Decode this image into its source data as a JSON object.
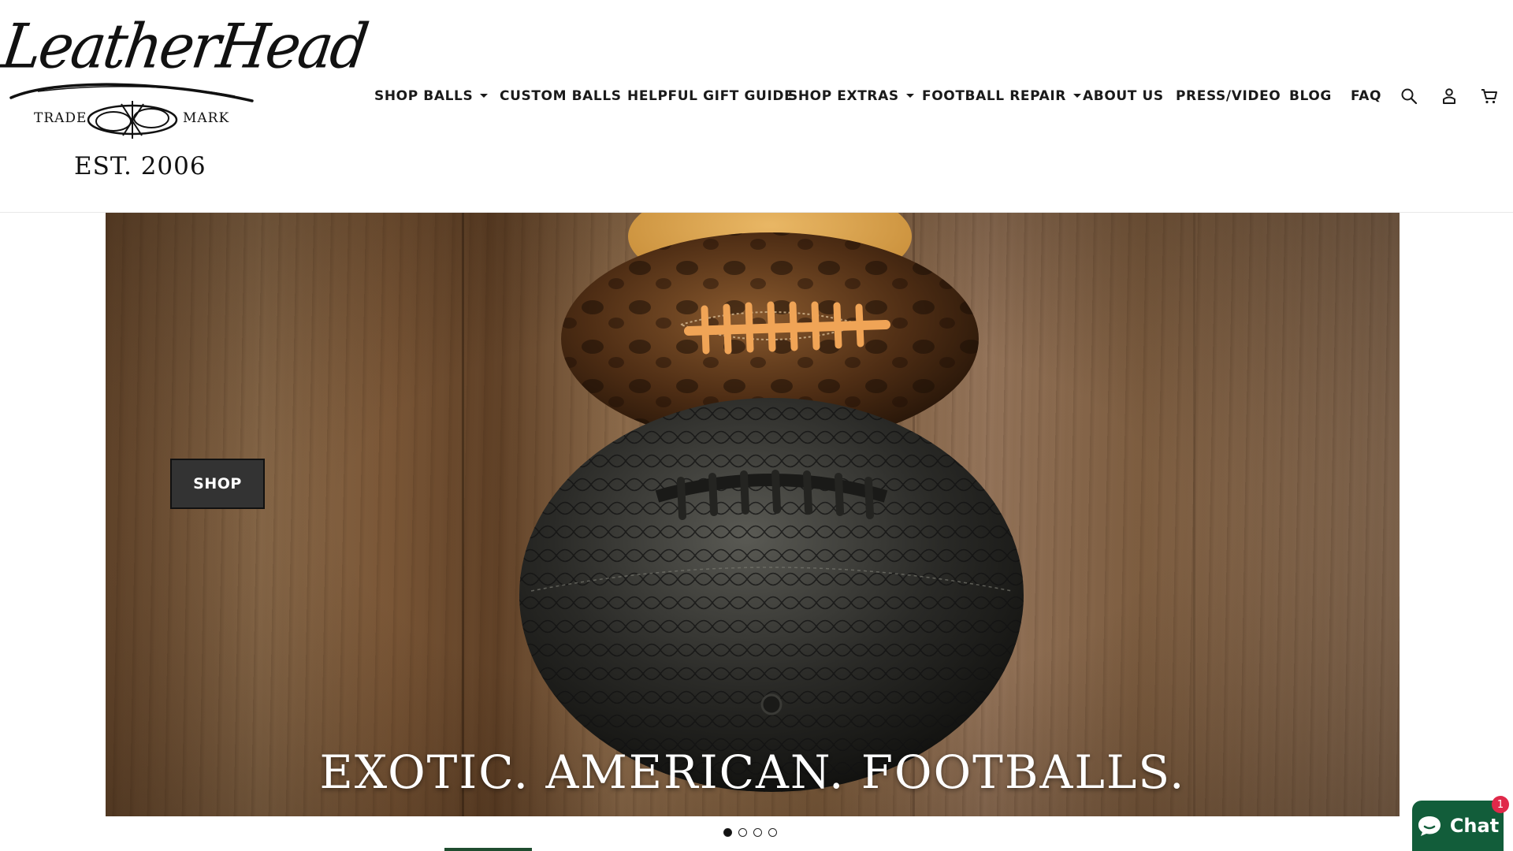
{
  "brand": {
    "script_name": "LeatherHead",
    "trade": "TRADE",
    "mark": "MARK",
    "established": "EST. 2006"
  },
  "nav": {
    "items": [
      {
        "label": "SHOP BALLS",
        "has_dropdown": true
      },
      {
        "label": "CUSTOM BALLS",
        "has_dropdown": false
      },
      {
        "label": "HELPFUL GIFT GUIDE",
        "has_dropdown": false
      },
      {
        "label": "SHOP EXTRAS",
        "has_dropdown": true
      },
      {
        "label": "FOOTBALL REPAIR",
        "has_dropdown": true
      },
      {
        "label": "ABOUT US",
        "has_dropdown": false
      },
      {
        "label": "PRESS/VIDEO",
        "has_dropdown": false
      },
      {
        "label": "BLOG",
        "has_dropdown": false
      },
      {
        "label": "FAQ",
        "has_dropdown": false
      }
    ],
    "icons": [
      "search-icon",
      "account-icon",
      "cart-icon"
    ]
  },
  "hero": {
    "button_label": "SHOP",
    "tagline": "EXOTIC.  AMERICAN.  FOOTBALLS.",
    "slide_count": 4,
    "active_slide": 1
  },
  "chat": {
    "label": "Chat",
    "badge_count": "1",
    "color": "#125d3a"
  },
  "colors": {
    "nav_text": "#1a1a1a",
    "shop_button_bg": "#333333",
    "chat_green": "#125d3a",
    "badge_red": "#e0294a"
  }
}
